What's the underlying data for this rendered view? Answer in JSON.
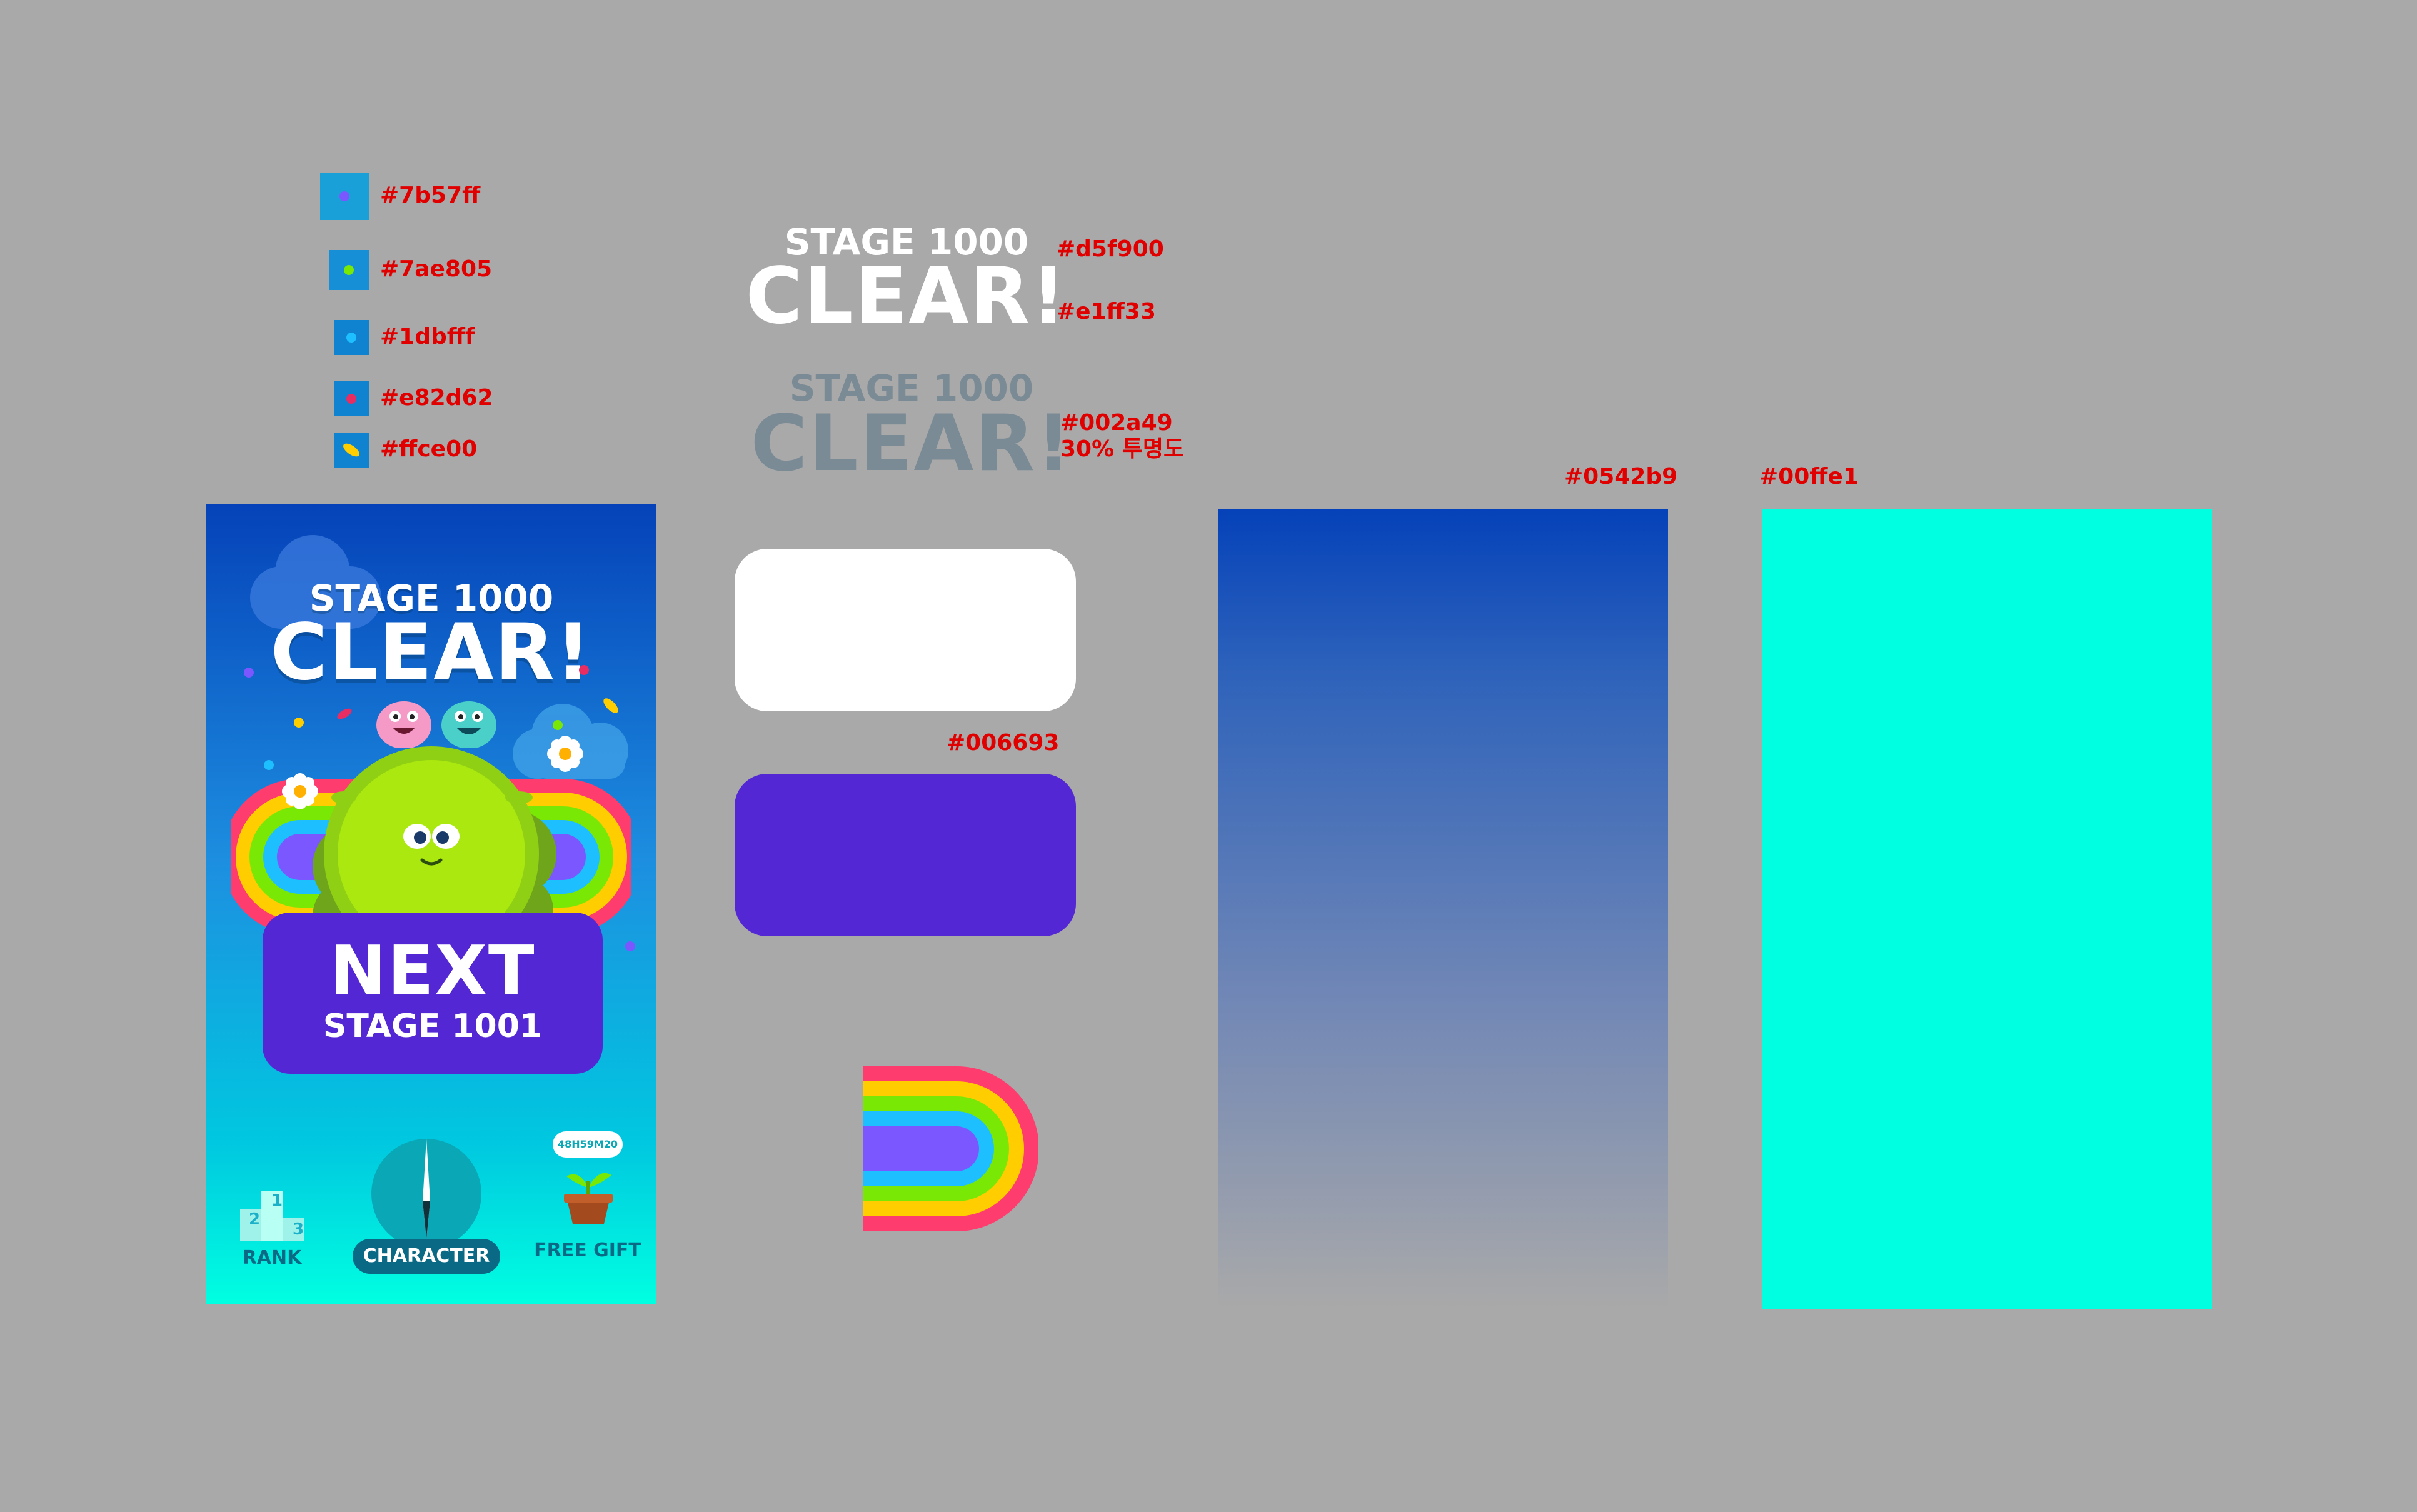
{
  "swatches": [
    {
      "label": "#7b57ff",
      "color": "#7b57ff"
    },
    {
      "label": "#7ae805",
      "color": "#7ae805"
    },
    {
      "label": "#1dbfff",
      "color": "#1dbfff"
    },
    {
      "label": "#e82d62",
      "color": "#e82d62"
    },
    {
      "label": "#ffce00",
      "color": "#ffce00"
    }
  ],
  "title_samples": {
    "stage_text": "STAGE 1000",
    "clear_text": "CLEAR!",
    "note_stage": "#d5f900",
    "note_clear": "#e1ff33",
    "note_shadow_color": "#002a49",
    "note_shadow_opacity": "30% 투명도"
  },
  "button_note": "#006693",
  "panels": {
    "gradient_note": "#0542b9",
    "cyan_note": "#00ffe1"
  },
  "phone": {
    "stage_text": "STAGE 1000",
    "clear_text": "CLEAR!",
    "next_label": "NEXT",
    "next_stage_label": "STAGE 1001",
    "nav": {
      "rank_label": "RANK",
      "character_label": "CHARACTER",
      "gift_label": "FREE GIFT",
      "gift_timer": "48H59M20"
    },
    "podium_numbers": [
      "1",
      "2",
      "3"
    ]
  },
  "colors": {
    "background": "#a9a9a9",
    "button_purple": "#5328d4",
    "gradient_top": "#0542b9",
    "cyan": "#00ffe1",
    "blob_green": "#abe80f",
    "annotation_red": "#e00000"
  }
}
